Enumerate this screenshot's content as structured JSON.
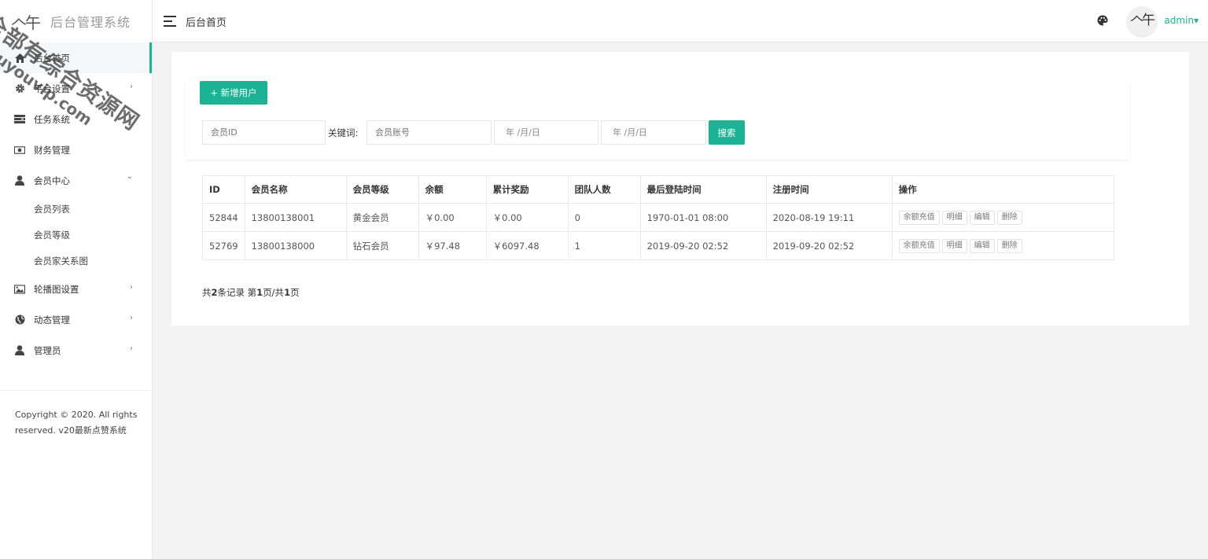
{
  "brand": {
    "logo": "𠆢午",
    "title": "后台管理系统"
  },
  "sidebar": {
    "items": [
      {
        "label": "后台首页",
        "icon": "home-icon",
        "active": true
      },
      {
        "label": "平台设置",
        "icon": "gear-icon",
        "arrow": "›"
      },
      {
        "label": "任务系统",
        "icon": "tasks-icon"
      },
      {
        "label": "财务管理",
        "icon": "money-icon"
      },
      {
        "label": "会员中心",
        "icon": "user-icon",
        "arrow": "⌄"
      },
      {
        "label": "轮播图设置",
        "icon": "image-icon",
        "arrow": "›"
      },
      {
        "label": "动态管理",
        "icon": "globe-icon",
        "arrow": "›"
      },
      {
        "label": "管理员",
        "icon": "user-icon",
        "arrow": "›"
      }
    ],
    "sub_items": [
      "会员列表",
      "会员等级",
      "会员家关系图"
    ],
    "copyright": "Copyright © 2020. All rights reserved. v20最新点赞系统"
  },
  "topbar": {
    "page_title": "后台首页",
    "avatar_text": "𠆢午",
    "user": "admin▾"
  },
  "toolbar": {
    "add_label": "+ 新增用户",
    "search_label": "搜索"
  },
  "filters": {
    "member_id_placeholder": "会员ID",
    "keyword_label": "关键词:",
    "account_placeholder": "会员账号",
    "date_start": "年 /月/日",
    "date_end": "年 /月/日"
  },
  "table": {
    "headers": [
      "ID",
      "会员名称",
      "会员等级",
      "余额",
      "累计奖励",
      "团队人数",
      "最后登陆时间",
      "注册时间",
      "操作"
    ],
    "rows": [
      [
        "52844",
        "13800138001",
        "黄金会员",
        "￥0.00",
        "￥0.00",
        "0",
        "1970-01-01 08:00",
        "2020-08-19 19:11"
      ],
      [
        "52769",
        "13800138000",
        "钻石会员",
        "￥97.48",
        "￥6097.48",
        "1",
        "2019-09-20 02:52",
        "2019-09-20 02:52"
      ]
    ],
    "actions": [
      "余额充值",
      "明细",
      "编辑",
      "删除"
    ]
  },
  "pager": {
    "prefix": "共",
    "total": "2",
    "mid1": "条记录 第",
    "page": "1",
    "mid2": "页/共",
    "pages": "1",
    "suffix": "页"
  },
  "watermark": {
    "line1": "全部有综合资源网",
    "line2": "douyouvip.com"
  },
  "colors": {
    "accent": "#1ab394",
    "background": "#f3f3f4"
  }
}
